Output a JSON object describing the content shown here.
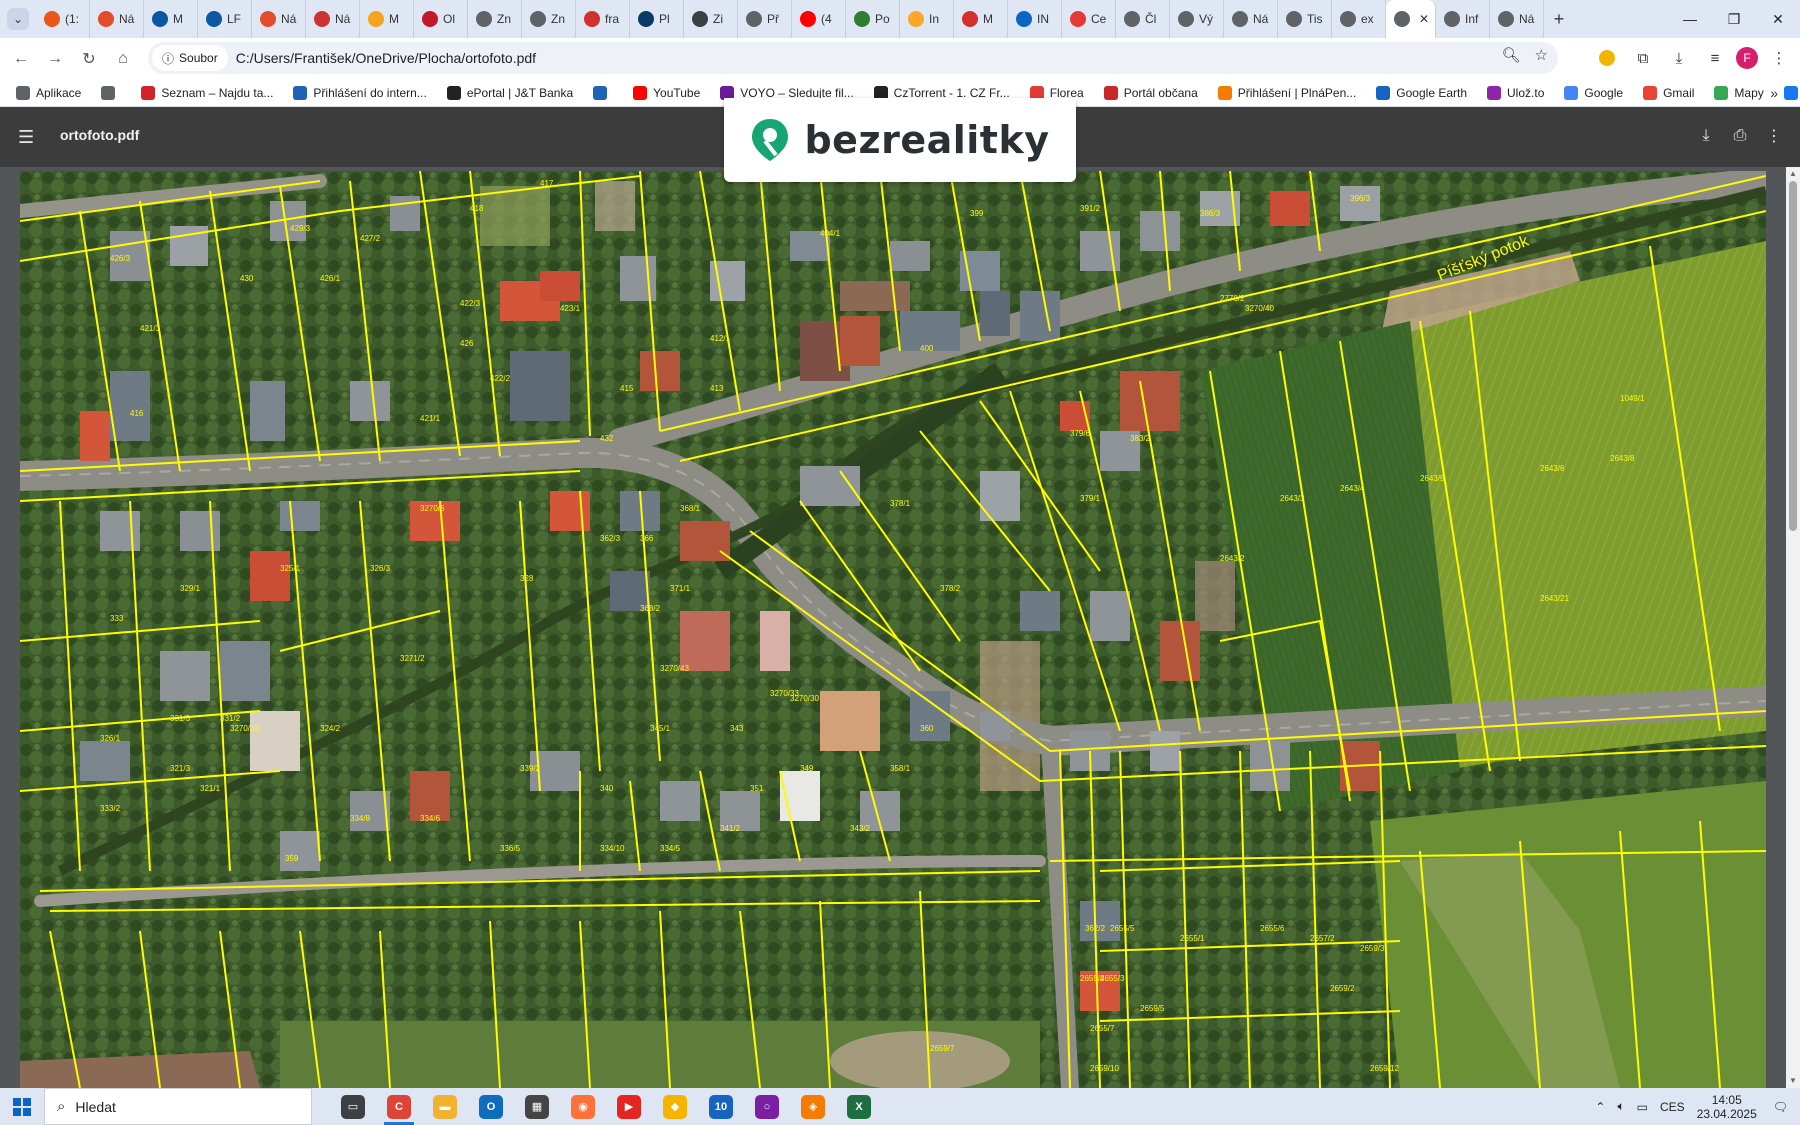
{
  "tabs": [
    {
      "label": "(1:",
      "color": "#e8571a"
    },
    {
      "label": "Ná",
      "color": "#e34c2a"
    },
    {
      "label": "M",
      "color": "#0b57a4"
    },
    {
      "label": "LF",
      "color": "#0b57a4"
    },
    {
      "label": "Ná",
      "color": "#e34c2a"
    },
    {
      "label": "Ná",
      "color": "#c33"
    },
    {
      "label": "M",
      "color": "#f4a51c"
    },
    {
      "label": "Ol",
      "color": "#c2192d"
    },
    {
      "label": "Zn",
      "color": "#5f6368"
    },
    {
      "label": "Zn",
      "color": "#5f6368"
    },
    {
      "label": "fra",
      "color": "#d32f2f"
    },
    {
      "label": "Pl",
      "color": "#0a3a66"
    },
    {
      "label": "Zi",
      "color": "#3c4043"
    },
    {
      "label": "Př",
      "color": "#5f6368"
    },
    {
      "label": "(4",
      "color": "#ff0000"
    },
    {
      "label": "Po",
      "color": "#2e7d32"
    },
    {
      "label": "In",
      "color": "#f9a825"
    },
    {
      "label": "M",
      "color": "#d32f2f"
    },
    {
      "label": "IN",
      "color": "#0a66c2"
    },
    {
      "label": "Ce",
      "color": "#e53935"
    },
    {
      "label": "Čl",
      "color": "#5f6368"
    },
    {
      "label": "Vý",
      "color": "#5f6368"
    },
    {
      "label": "Ná",
      "color": "#5f6368"
    },
    {
      "label": "Tis",
      "color": "#5f6368"
    },
    {
      "label": "ex",
      "color": "#5f6368"
    },
    {
      "label": "",
      "color": "#5f6368",
      "active": true
    },
    {
      "label": "Inf",
      "color": "#5f6368"
    },
    {
      "label": "Ná",
      "color": "#5f6368"
    }
  ],
  "address": {
    "chip_label": "Soubor",
    "url": "C:/Users/František/OneDrive/Plocha/ortofoto.pdf"
  },
  "profile_initial": "F",
  "bookmarks": [
    {
      "label": "Aplikace",
      "color": "#5f6368"
    },
    {
      "label": "",
      "color": "#5f6368"
    },
    {
      "label": "Seznam – Najdu ta...",
      "color": "#d2232a"
    },
    {
      "label": "Přihlášení do intern...",
      "color": "#1e63b5"
    },
    {
      "label": "ePortal | J&T Banka",
      "color": "#222222"
    },
    {
      "label": "",
      "color": "#1e63b5"
    },
    {
      "label": "YouTube",
      "color": "#ff0000"
    },
    {
      "label": "VOYO – Sledujte fil...",
      "color": "#6a1b9a"
    },
    {
      "label": "CzTorrent - 1. CZ Fr...",
      "color": "#222222"
    },
    {
      "label": "Florea",
      "color": "#e53935"
    },
    {
      "label": "Portál občana",
      "color": "#c62828"
    },
    {
      "label": "Přihlášení | PlnáPen...",
      "color": "#f57c00"
    },
    {
      "label": "Google Earth",
      "color": "#1565c0"
    },
    {
      "label": "Ulož.to",
      "color": "#8e24aa"
    },
    {
      "label": "Google",
      "color": "#4285f4"
    },
    {
      "label": "Gmail",
      "color": "#ea4335"
    },
    {
      "label": "Mapy",
      "color": "#34a853"
    },
    {
      "label": "9",
      "color": "#1877f2"
    }
  ],
  "pdf": {
    "title": "ortofoto.pdf"
  },
  "logo": {
    "text": "bezrealitky",
    "brand_color": "#17a673"
  },
  "map": {
    "stream_label": "Píšťský potok",
    "parcel_labels": [
      "429/3",
      "427/2",
      "418",
      "417",
      "423/1",
      "404/1",
      "399",
      "391/2",
      "386/3",
      "396/3",
      "426/3",
      "430",
      "426/1",
      "422/3",
      "412/1",
      "426",
      "421/3",
      "400",
      "415",
      "413",
      "416",
      "422/2",
      "432",
      "421/1",
      "383/2",
      "379/6",
      "379/1",
      "378/1",
      "378/2",
      "2643/3",
      "2643/4",
      "2643/5",
      "2643/6",
      "2643/21",
      "2643/8",
      "2643/2",
      "325/1",
      "326/3",
      "328",
      "362/3",
      "366",
      "368/1",
      "371/1",
      "368/2",
      "329/1",
      "333",
      "331/3",
      "331/2",
      "324/2",
      "326/1",
      "321/3",
      "321/1",
      "333/2",
      "339/2",
      "340",
      "345/1",
      "343",
      "351",
      "349",
      "360",
      "358/1",
      "359",
      "334/8",
      "334/6",
      "336/5",
      "334/10",
      "334/5",
      "341/2",
      "343/2",
      "362/2",
      "2655/5",
      "2655/4",
      "2655/3",
      "2655/1",
      "2655/6",
      "2657/2",
      "2659/3",
      "2659/2",
      "2659/5",
      "2655/7",
      "2659/10",
      "2659/12",
      "2659/7",
      "2778/2",
      "3270/40",
      "3270/30",
      "3270/33",
      "3270/43",
      "3270/38",
      "3271/2",
      "3270/6",
      "1049/1",
      "2643/9"
    ]
  },
  "taskbar": {
    "search_placeholder": "Hledat",
    "apps": [
      {
        "name": "task-view",
        "color": "#3c4043",
        "glyph": "▭"
      },
      {
        "name": "chrome",
        "color": "#db4437",
        "glyph": "C"
      },
      {
        "name": "explorer",
        "color": "#f2b230",
        "glyph": "▬"
      },
      {
        "name": "outlook",
        "color": "#0f6cbd",
        "glyph": "O"
      },
      {
        "name": "calculator",
        "color": "#444444",
        "glyph": "▦"
      },
      {
        "name": "firefox",
        "color": "#ff7139",
        "glyph": "◉"
      },
      {
        "name": "media",
        "color": "#e52521",
        "glyph": "▶"
      },
      {
        "name": "app-yellow",
        "color": "#f4b400",
        "glyph": "◆"
      },
      {
        "name": "app-badge",
        "color": "#1565c0",
        "glyph": "10"
      },
      {
        "name": "app-ring",
        "color": "#7b1fa2",
        "glyph": "○"
      },
      {
        "name": "app-orange",
        "color": "#f57c00",
        "glyph": "◈"
      },
      {
        "name": "excel",
        "color": "#1d6f42",
        "glyph": "X"
      }
    ],
    "language": "CES",
    "time": "14:05",
    "date": "23.04.2025"
  }
}
